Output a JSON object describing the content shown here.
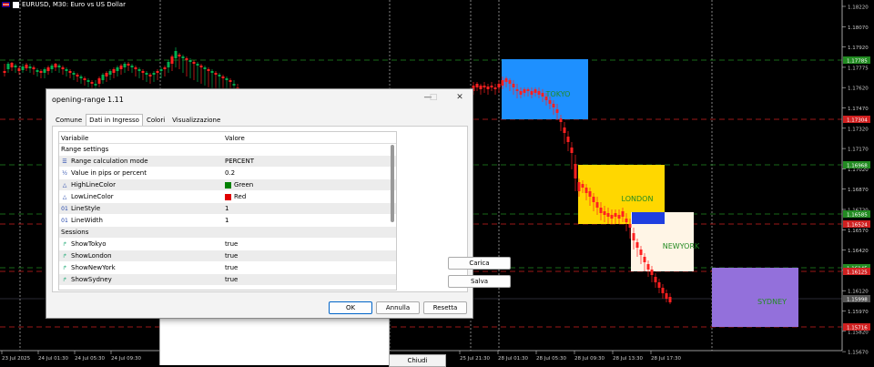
{
  "window": {
    "title": "EURUSD, M30:  Euro vs US Dollar"
  },
  "colors": {
    "bg": "#000000",
    "bull": "#00b050",
    "bear": "#ff2020",
    "tokyo": "#1e90ff",
    "london": "#ffd700",
    "newyork": "#fff5e6",
    "sydney": "#9370db",
    "red_line": "#d02020",
    "green_line": "#228b22"
  },
  "sessions_boxes": [
    {
      "name": "TOKYO",
      "label_color": "#228b22"
    },
    {
      "name": "LONDON",
      "label_color": "#228b22"
    },
    {
      "name": "NEWYORK",
      "label_color": "#228b22"
    },
    {
      "name": "SYDNEY",
      "label_color": "#228b22"
    }
  ],
  "price_axis": [
    "1.18220",
    "1.18070",
    "1.17920",
    "1.17775",
    "1.17620",
    "1.17470",
    "1.17320",
    "1.17170",
    "1.17020",
    "1.16870",
    "1.16720",
    "1.16570",
    "1.16420",
    "1.16270",
    "1.16120",
    "1.15970",
    "1.15820",
    "1.15670"
  ],
  "price_tags": [
    {
      "label": "1.17785",
      "color": "#228b22"
    },
    {
      "label": "1.17304",
      "color": "#d02020"
    },
    {
      "label": "1.16968",
      "color": "#228b22"
    },
    {
      "label": "1.16585",
      "color": "#228b22"
    },
    {
      "label": "1.16524",
      "color": "#d02020"
    },
    {
      "label": "1.16145",
      "color": "#228b22"
    },
    {
      "label": "1.16125",
      "color": "#d02020"
    },
    {
      "label": "1.15998",
      "color": "#555555"
    },
    {
      "label": "1.15716",
      "color": "#d02020"
    }
  ],
  "time_axis": [
    "23 Jul 2025",
    "24 Jul 01:30",
    "24 Jul 05:30",
    "24 Jul 09:30",
    "25 Jul 21:30",
    "28 Jul 01:30",
    "28 Jul 05:30",
    "28 Jul 09:30",
    "28 Jul 13:30",
    "28 Jul 17:30"
  ],
  "dialog": {
    "title": "opening-range 1.11",
    "tabs": [
      "Comune",
      "Dati in Ingresso",
      "Colori",
      "Visualizzazione"
    ],
    "active_tab": 1,
    "col_variable": "Variabile",
    "col_value": "Valore",
    "rows": [
      {
        "type": "group",
        "name": "Range settings",
        "value": ""
      },
      {
        "type": "enum",
        "name": "Range calculation mode",
        "value": "PERCENT"
      },
      {
        "type": "double",
        "name": "Value in pips or percent",
        "value": "0.2"
      },
      {
        "type": "color",
        "name": "HighLineColor",
        "value": "Green",
        "swatch": "#008000"
      },
      {
        "type": "color",
        "name": "LowLineColor",
        "value": "Red",
        "swatch": "#e00000"
      },
      {
        "type": "int",
        "name": "LineStyle",
        "value": "1"
      },
      {
        "type": "int",
        "name": "LineWidth",
        "value": "1"
      },
      {
        "type": "group",
        "name": "Sessions",
        "value": ""
      },
      {
        "type": "bool",
        "name": "ShowTokyo",
        "value": "true"
      },
      {
        "type": "bool",
        "name": "ShowLondon",
        "value": "true"
      },
      {
        "type": "bool",
        "name": "ShowNewYork",
        "value": "true"
      },
      {
        "type": "bool",
        "name": "ShowSydney",
        "value": "true"
      }
    ],
    "load_label": "Carica",
    "save_label": "Salva",
    "ok_label": "OK",
    "cancel_label": "Annulla",
    "reset_label": "Resetta"
  },
  "close_label": "Chiudi"
}
